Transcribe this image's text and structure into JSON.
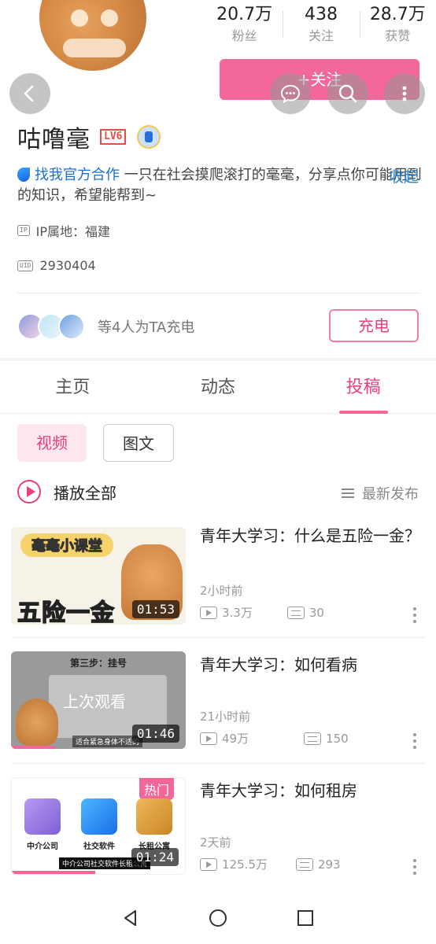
{
  "profile": {
    "name": "咕噜毫",
    "level": "LV6",
    "stats": [
      {
        "value": "20.7万",
        "label": "粉丝"
      },
      {
        "value": "438",
        "label": "关注"
      },
      {
        "value": "28.7万",
        "label": "获赞"
      }
    ],
    "follow_label": "+关注",
    "bio_brand": "找我官方合作",
    "bio_text": "一只在社会摸爬滚打的毫毫，分享点你可能用到的知识，希望能帮到~",
    "collapse_label": "收起",
    "ip_label": "IP属地：福建",
    "uid": "2930404",
    "charge_text": "等4人为TA充电",
    "charge_button": "充电"
  },
  "tabs": [
    {
      "label": "主页",
      "active": false
    },
    {
      "label": "动态",
      "active": false
    },
    {
      "label": "投稿",
      "active": true
    }
  ],
  "filters": {
    "video": "视频",
    "image_text": "图文"
  },
  "list_header": {
    "play_all": "播放全部",
    "sort": "最新发布"
  },
  "videos": [
    {
      "title": "青年大学习：什么是五险一金？",
      "time": "2小时前",
      "views": "3.3万",
      "danmaku": "30",
      "duration": "01:53",
      "thumb_tag": "毫毫小课堂",
      "thumb_text": "五险一金"
    },
    {
      "title": "青年大学习：如何看病",
      "time": "21小时前",
      "views": "49万",
      "danmaku": "150",
      "duration": "01:46",
      "thumb_header": "第三步：挂号",
      "thumb_overlay": "上次观看",
      "thumb_sub": "适合紧急身体不适的",
      "watched": 0.25
    },
    {
      "title": "青年大学习：如何租房",
      "time": "2天前",
      "views": "125.5万",
      "danmaku": "293",
      "duration": "01:24",
      "hot_label": "热门",
      "thumb_labels": [
        "中介公司",
        "社交软件",
        "长租公寓"
      ],
      "thumb_caption": "中介公司社交软件长租公寓",
      "watched": 0.48
    }
  ],
  "colors": {
    "accent": "#f3679a",
    "link": "#1e7fcf"
  }
}
